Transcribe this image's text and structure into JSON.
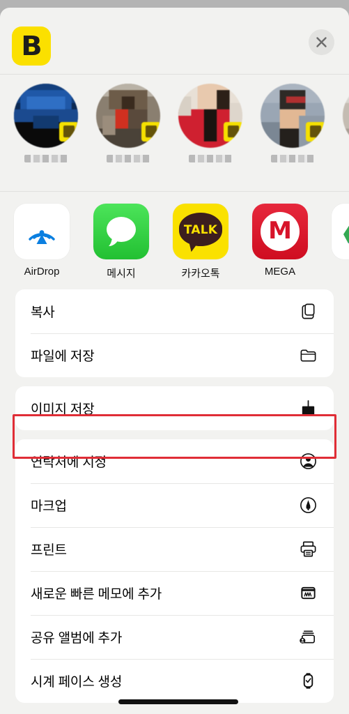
{
  "sheet": {
    "app_logo_letter": "B",
    "close_label": "✕",
    "close_icon": "close-icon"
  },
  "contacts": {
    "items": [
      {
        "name_redacted": "████",
        "badge": "kakaotalk-badge"
      },
      {
        "name_redacted": "█████",
        "badge": "kakaotalk-badge"
      },
      {
        "name_redacted": "███",
        "badge": "kakaotalk-badge"
      },
      {
        "name_redacted": "██████",
        "badge": "kakaotalk-badge"
      }
    ]
  },
  "apps": {
    "items": [
      {
        "label": "AirDrop",
        "icon": "airdrop-icon"
      },
      {
        "label": "메시지",
        "icon": "messages-icon"
      },
      {
        "label": "카카오톡",
        "icon": "kakaotalk-icon",
        "mark": "TALK"
      },
      {
        "label": "MEGA",
        "icon": "mega-icon",
        "mark": "M"
      },
      {
        "label": "",
        "icon": "drive-icon"
      }
    ]
  },
  "actions": {
    "groups": [
      {
        "rows": [
          {
            "label": "복사",
            "icon": "copy-icon"
          },
          {
            "label": "파일에 저장",
            "icon": "folder-icon"
          }
        ]
      },
      {
        "rows": [
          {
            "label": "이미지 저장",
            "icon": "save-image-icon",
            "highlighted": true
          }
        ]
      },
      {
        "rows": [
          {
            "label": "연락처에 지정",
            "icon": "contact-icon"
          },
          {
            "label": "마크업",
            "icon": "markup-icon"
          },
          {
            "label": "프린트",
            "icon": "printer-icon"
          },
          {
            "label": "새로운 빠른 메모에 추가",
            "icon": "quick-note-icon"
          },
          {
            "label": "공유 앨범에 추가",
            "icon": "shared-album-icon"
          },
          {
            "label": "시계 페이스 생성",
            "icon": "watch-face-icon",
            "redacted": true
          }
        ]
      }
    ]
  },
  "colors": {
    "page_background": "#b4b4b4",
    "sheet_background": "#f2f2f0",
    "card_background": "#ffffff",
    "highlight_red": "#e02d36",
    "kakao_yellow": "#fae100",
    "mega_red": "#d7142a",
    "messages_green": "#22c032",
    "airdrop_blue": "#0b7fe0",
    "logo_yellow": "#fbe000",
    "text_primary": "#000000"
  }
}
